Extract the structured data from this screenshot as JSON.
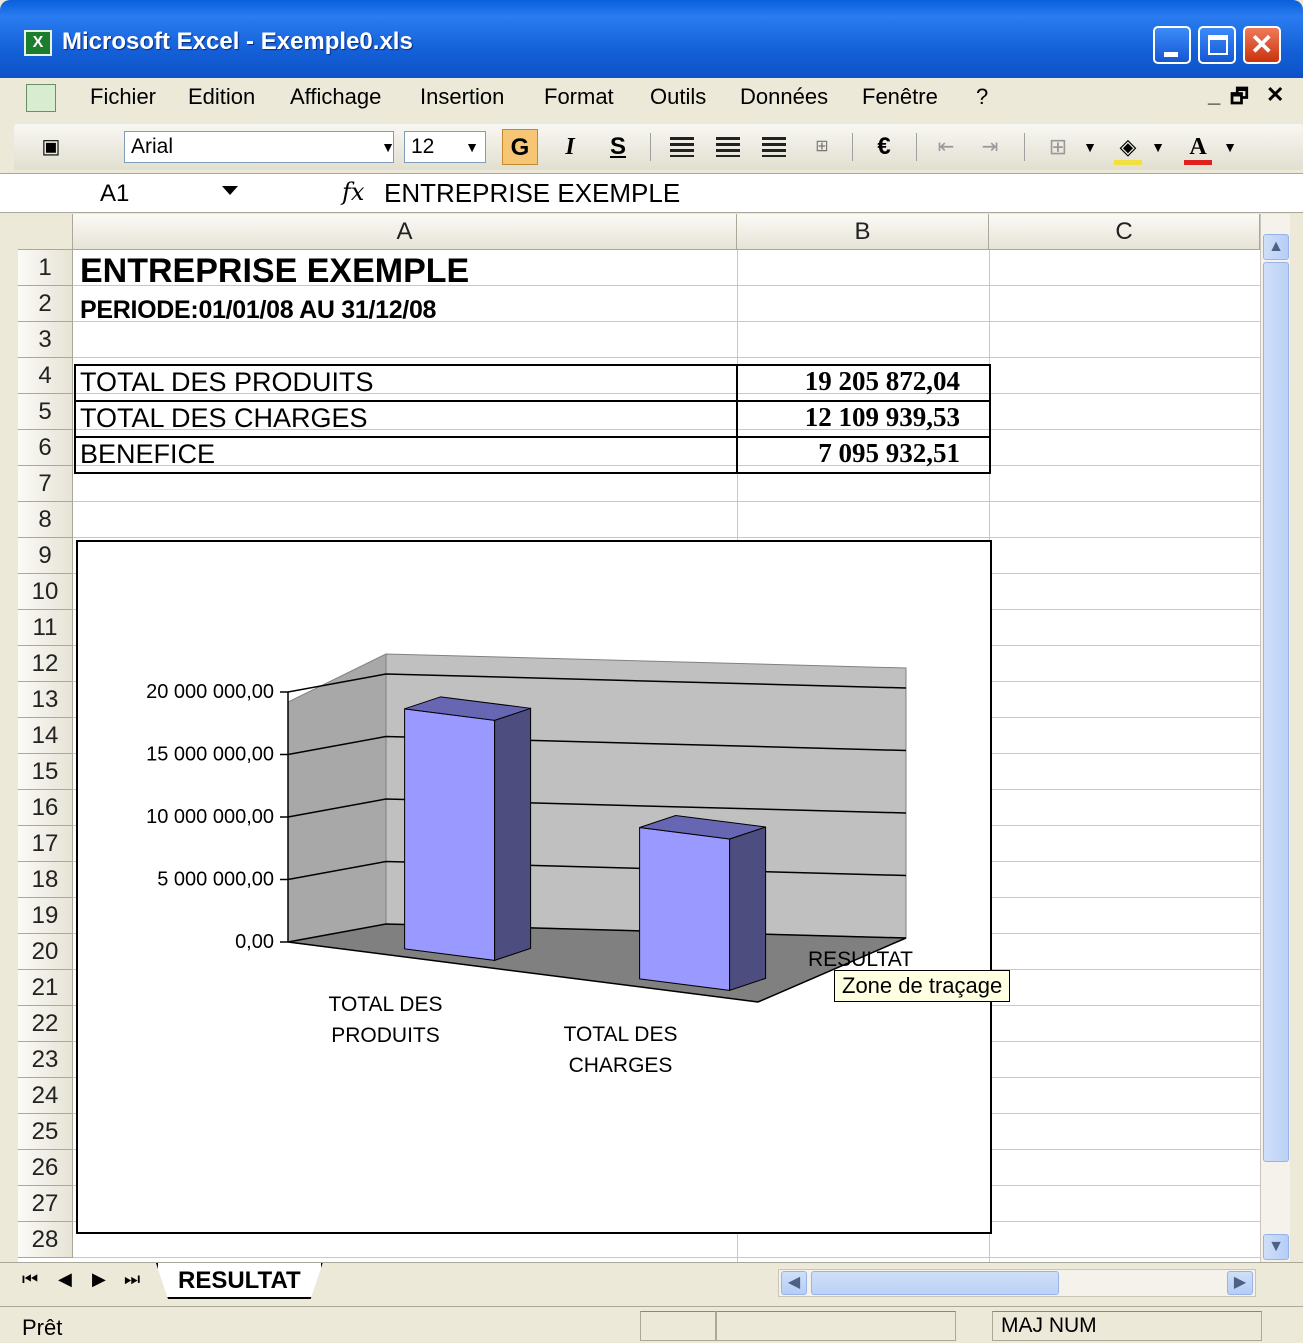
{
  "window": {
    "title": "Microsoft Excel - Exemple0.xls",
    "close_glyph": "✕"
  },
  "menu": {
    "items": [
      "Fichier",
      "Edition",
      "Affichage",
      "Insertion",
      "Format",
      "Outils",
      "Données",
      "Fenêtre",
      "?"
    ],
    "doc_controls": [
      "_",
      "🗗",
      "✕"
    ]
  },
  "toolbar": {
    "font_name": "Arial",
    "font_size": "12",
    "bold_label": "G",
    "italic_label": "I",
    "underline_label": "S",
    "euro_label": "€",
    "font_color_label": "A",
    "fill_color": "#f0e040",
    "font_color": "#e02020"
  },
  "formula_bar": {
    "name_box": "A1",
    "fx_label": "fx",
    "content": "ENTREPRISE EXEMPLE"
  },
  "sheet": {
    "columns": [
      "A",
      "B",
      "C"
    ],
    "rows": [
      "1",
      "2",
      "3",
      "4",
      "5",
      "6",
      "7",
      "8",
      "9",
      "10",
      "11",
      "12",
      "13",
      "14",
      "15",
      "16",
      "17",
      "18",
      "19",
      "20",
      "21",
      "22",
      "23",
      "24",
      "25",
      "26",
      "27",
      "28"
    ],
    "a1": "ENTREPRISE EXEMPLE",
    "a2": "PERIODE:01/01/08 AU 31/12/08",
    "table": [
      {
        "label": "TOTAL DES PRODUITS",
        "value": "19 205 872,04"
      },
      {
        "label": "TOTAL DES CHARGES",
        "value": "12 109 939,53"
      },
      {
        "label": "BENEFICE",
        "value": "7 095 932,51"
      }
    ]
  },
  "chart_data": {
    "type": "bar",
    "style": "3d-column",
    "title": "",
    "categories": [
      "TOTAL DES PRODUITS",
      "TOTAL DES CHARGES"
    ],
    "category_lines": [
      [
        "TOTAL DES",
        "PRODUITS"
      ],
      [
        "TOTAL DES",
        "CHARGES"
      ]
    ],
    "values": [
      19205872.04,
      12109939.53
    ],
    "series_label": "RESULTAT",
    "yticks": [
      "0,00",
      "5 000 000,00",
      "10 000 000,00",
      "15 000 000,00",
      "20 000 000,00"
    ],
    "ylim": [
      0,
      20000000
    ],
    "grid": true,
    "bar_color": "#9999ff",
    "wall_color": "#c0c0c0",
    "floor_color": "#808080"
  },
  "tooltip": "Zone de traçage",
  "tabs": {
    "nav": [
      "⏮",
      "◀",
      "▶",
      "⏭"
    ],
    "sheet_name": "RESULTAT"
  },
  "status": {
    "left": "Prêt",
    "indicators": "MAJ NUM"
  }
}
